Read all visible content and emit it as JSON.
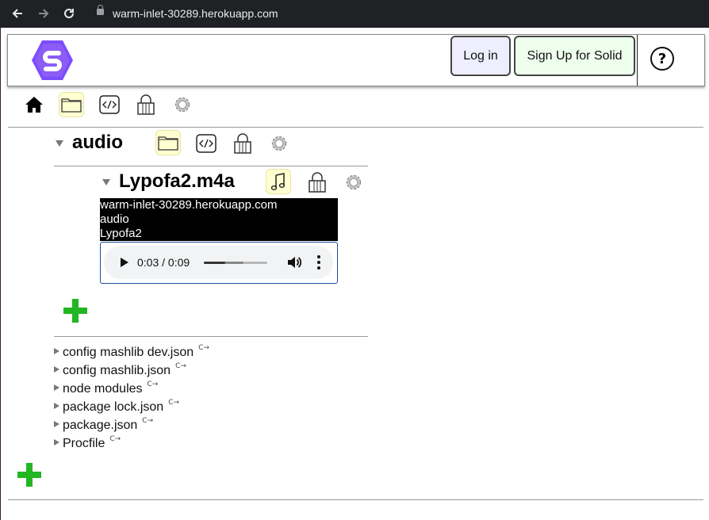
{
  "browser": {
    "url": "warm-inlet-30289.herokuapp.com",
    "back_icon": "arrow-left-icon",
    "forward_icon": "arrow-right-icon",
    "reload_icon": "reload-icon"
  },
  "header": {
    "login_label": "Log in",
    "signup_label": "Sign Up for Solid",
    "help_label": "?"
  },
  "root_toolbar": {
    "icons": [
      "home-icon",
      "folder-icon",
      "source-code-icon",
      "lock-icon",
      "gear-icon"
    ],
    "selected": "folder-icon"
  },
  "folder": {
    "name": "audio",
    "icons": [
      "folder-icon",
      "source-code-icon",
      "lock-icon",
      "gear-icon"
    ],
    "selected": "folder-icon"
  },
  "file": {
    "name": "Lypofa2.m4a",
    "icons": [
      "music-note-icon",
      "lock-icon",
      "gear-icon"
    ],
    "selected": "music-note-icon",
    "media_lines": [
      "warm-inlet-30289.herokuapp.com",
      "audio",
      "Lypofa2"
    ],
    "player": {
      "time": "0:03 / 0:09",
      "played_fraction": 0.333,
      "buffered_fraction": 0.63
    }
  },
  "root_items": [
    {
      "name": "config mashlib dev.json"
    },
    {
      "name": "config mashlib.json"
    },
    {
      "name": "node modules"
    },
    {
      "name": "package lock.json"
    },
    {
      "name": "package.json"
    },
    {
      "name": "Procfile"
    }
  ],
  "colors": {
    "plus": "#22b622",
    "selected_bg": "#ffffd0",
    "login_bg": "#eeeeff",
    "signup_bg": "#eeffee",
    "logo": "#7c4dff"
  }
}
